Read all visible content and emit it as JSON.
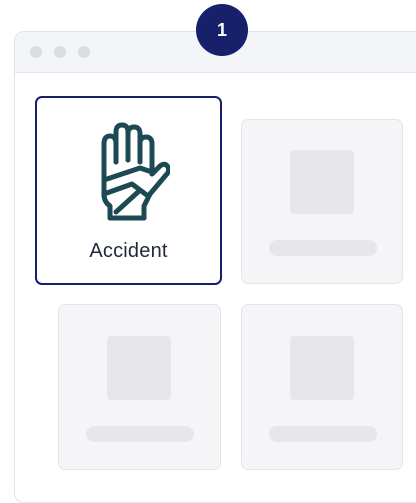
{
  "step": {
    "number": "1"
  },
  "window": {
    "controls": [
      "window-dot",
      "window-dot",
      "window-dot"
    ]
  },
  "cards": [
    {
      "label": "Accident",
      "icon": "bandaged-hand-icon",
      "selected": true
    },
    {
      "placeholder": true
    },
    {
      "placeholder": true
    },
    {
      "placeholder": true
    }
  ],
  "colors": {
    "accent": "#16206b",
    "icon": "#1c4a52",
    "placeholder": "#e6e6eb",
    "card_background": "#f5f5f8"
  }
}
